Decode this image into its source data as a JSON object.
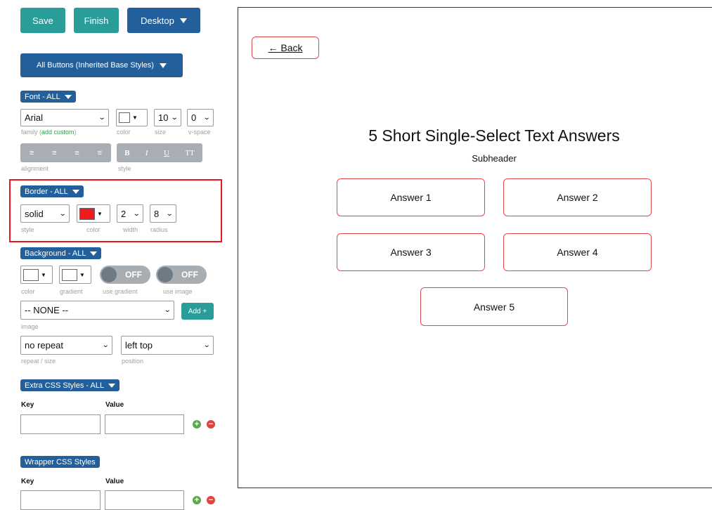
{
  "toolbar": {
    "save_label": "Save",
    "finish_label": "Finish",
    "device_label": "Desktop"
  },
  "button_group": {
    "label": "All Buttons (Inherited Base Styles)"
  },
  "font_section": {
    "header": "Font - ALL",
    "family": "Arial",
    "family_label": "family (",
    "add_custom": "add custom",
    "family_label_end": ")",
    "color_label": "color",
    "size": "10",
    "size_label": "size",
    "vspace": "0",
    "vspace_label": "v-space",
    "alignment_label": "alignment",
    "style_label": "style",
    "style_buttons": [
      "B",
      "I",
      "U",
      "TT"
    ]
  },
  "border_section": {
    "header": "Border - ALL",
    "style": "solid",
    "style_label": "style",
    "color_label": "color",
    "color": "#ee1c1c",
    "width": "2",
    "width_label": "width",
    "radius": "8",
    "radius_label": "radius"
  },
  "background_section": {
    "header": "Background - ALL",
    "color_label": "color",
    "gradient_label": "gradient",
    "use_gradient_label": "use gradient",
    "use_gradient_state": "OFF",
    "use_image_label": "use image",
    "use_image_state": "OFF",
    "image_value": "-- NONE --",
    "image_label": "image",
    "add_label": "Add +",
    "repeat_value": "no repeat",
    "repeat_label": "repeat / size",
    "position_value": "left top",
    "position_label": "position"
  },
  "extra_css": {
    "header": "Extra CSS Styles - ALL",
    "key_label": "Key",
    "value_label": "Value"
  },
  "wrapper_css": {
    "header": "Wrapper CSS Styles",
    "key_label": "Key",
    "value_label": "Value"
  },
  "preview": {
    "back_label": "← Back",
    "title": "5 Short Single-Select Text Answers",
    "subheader": "Subheader",
    "answers": [
      "Answer 1",
      "Answer 2",
      "Answer 3",
      "Answer 4",
      "Answer 5"
    ]
  },
  "colors": {
    "teal": "#2a9d9a",
    "navy": "#23609b",
    "highlight": "#e5171f",
    "answer_border": "#e34a4a"
  }
}
